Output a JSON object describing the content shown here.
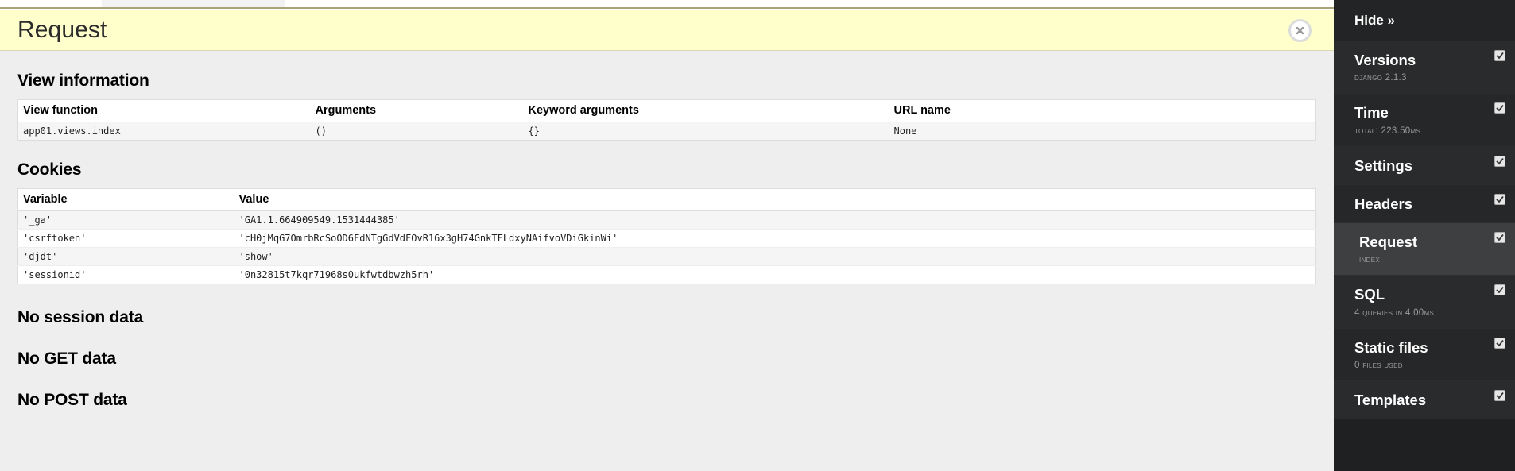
{
  "panel": {
    "title": "Request",
    "close_icon": "close-circle-icon"
  },
  "view_information": {
    "heading": "View information",
    "columns": [
      "View function",
      "Arguments",
      "Keyword arguments",
      "URL name"
    ],
    "rows": [
      {
        "view_function": "app01.views.index",
        "arguments": "()",
        "keyword_arguments": "{}",
        "url_name": "None"
      }
    ]
  },
  "cookies": {
    "heading": "Cookies",
    "columns": [
      "Variable",
      "Value"
    ],
    "rows": [
      {
        "variable": "'_ga'",
        "value": "'GA1.1.664909549.1531444385'"
      },
      {
        "variable": "'csrftoken'",
        "value": "'cH0jMqG7OmrbRcSoOD6FdNTgGdVdFOvR16x3gH74GnkTFLdxyNAifvoVDiGkinWi'"
      },
      {
        "variable": "'djdt'",
        "value": "'show'"
      },
      {
        "variable": "'sessionid'",
        "value": "'0n32815t7kqr71968s0ukfwtdbwzh5rh'"
      }
    ]
  },
  "empty_sections": [
    "No session data",
    "No GET data",
    "No POST data"
  ],
  "toolbar": {
    "hide_label": "Hide »",
    "panels": [
      {
        "label": "Versions",
        "sub": "Django 2.1.3",
        "checked": true,
        "active": false
      },
      {
        "label": "Time",
        "sub": "Total: 223.50ms",
        "checked": true,
        "active": false
      },
      {
        "label": "Settings",
        "sub": "",
        "checked": true,
        "active": false
      },
      {
        "label": "Headers",
        "sub": "",
        "checked": true,
        "active": false
      },
      {
        "label": "Request",
        "sub": "index",
        "checked": true,
        "active": true
      },
      {
        "label": "SQL",
        "sub": "4 queries in 4.00ms",
        "checked": true,
        "active": false
      },
      {
        "label": "Static files",
        "sub": "0 files used",
        "checked": true,
        "active": false
      },
      {
        "label": "Templates",
        "sub": "",
        "checked": true,
        "active": false
      }
    ]
  },
  "colors": {
    "header_bg": "#ffffcc",
    "panel_bg": "#eeeeee",
    "toolbar_bg": "#1f2021",
    "active_panel_bg": "#3e3f40",
    "keyword_value": "#8a1f1f"
  }
}
